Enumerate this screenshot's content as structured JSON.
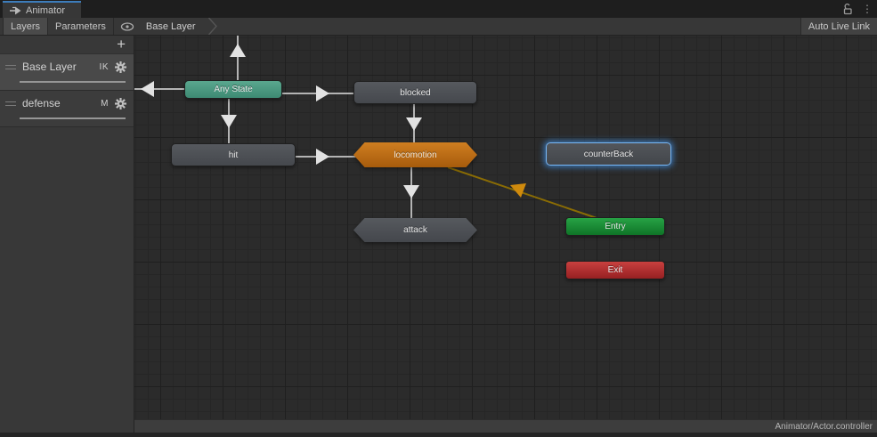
{
  "window": {
    "tab_title": "Animator",
    "status_bar_text": "Animator/Actor.controller"
  },
  "toolbar": {
    "layers_label": "Layers",
    "parameters_label": "Parameters",
    "breadcrumb": "Base Layer",
    "auto_live_link_label": "Auto Live Link"
  },
  "sidebar": {
    "add_button_label": "+",
    "layers": [
      {
        "name": "Base Layer",
        "badge": "IK",
        "selected": true
      },
      {
        "name": "defense",
        "badge": "M",
        "selected": false
      }
    ]
  },
  "canvas": {
    "nodes": [
      {
        "id": "any-state",
        "label": "Any State",
        "kind": "any-state"
      },
      {
        "id": "blocked",
        "label": "blocked",
        "kind": "state"
      },
      {
        "id": "hit",
        "label": "hit",
        "kind": "state"
      },
      {
        "id": "locomotion",
        "label": "locomotion",
        "kind": "default-state"
      },
      {
        "id": "counterBack",
        "label": "counterBack",
        "kind": "state-selected"
      },
      {
        "id": "attack",
        "label": "attack",
        "kind": "state"
      },
      {
        "id": "entry",
        "label": "Entry",
        "kind": "entry"
      },
      {
        "id": "exit",
        "label": "Exit",
        "kind": "exit"
      }
    ],
    "transitions": [
      {
        "from": "any-state",
        "to": "offscreen-top"
      },
      {
        "from": "any-state",
        "to": "offscreen-left"
      },
      {
        "from": "any-state",
        "to": "blocked"
      },
      {
        "from": "any-state",
        "to": "hit"
      },
      {
        "from": "blocked",
        "to": "locomotion"
      },
      {
        "from": "hit",
        "to": "locomotion"
      },
      {
        "from": "locomotion",
        "to": "attack"
      },
      {
        "from": "entry",
        "to": "locomotion"
      }
    ],
    "colors": {
      "any_state": "#4c9a81",
      "default_state": "#bc6d15",
      "state_gray": "#4d5055",
      "selection_outline": "#7ab8f5",
      "entry_green": "#1b8c36",
      "exit_red": "#ae3032",
      "transition_gray": "#b4b4b4",
      "transition_entry": "#8a6c04",
      "tab_accent": "#3d7dbb"
    }
  },
  "icons": {
    "animator": "animator-icon",
    "eye": "eye-icon",
    "lock": "unlock-icon",
    "kebab": "kebab-menu-icon",
    "gear": "gear-icon",
    "plus": "plus-icon",
    "chevron": "breadcrumb-chevron-icon"
  }
}
